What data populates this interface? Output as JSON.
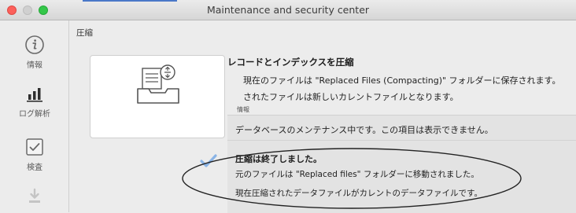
{
  "window": {
    "title": "Maintenance and security center"
  },
  "sidebar": {
    "items": [
      {
        "label": "情報",
        "icon": "info-icon"
      },
      {
        "label": "ログ解析",
        "icon": "bar-chart-icon"
      },
      {
        "label": "検査",
        "icon": "checkbox-icon"
      },
      {
        "label": "",
        "icon": "download-icon"
      }
    ]
  },
  "main": {
    "section_title": "圧縮",
    "operation": {
      "thumbnail_icon": "compact-tray-icon",
      "heading": "レコードとインデックスを圧縮",
      "desc_line1": "現在のファイルは \"Replaced Files (Compacting)\" フォルダーに保存されます。",
      "desc_line2": "されたファイルは新しいカレントファイルとなります。",
      "info_label": "情報"
    },
    "panel": {
      "maintenance_message": "データベースのメンテナンス中です。この項目は表示できません。",
      "done_title": "圧縮は終了しました。",
      "done_line1": "元のファイルは \"Replaced files\" フォルダーに移動されました。",
      "done_line2": "現在圧縮されたデータファイルがカレントのデータファイルです。",
      "status_icon": "checkmark-icon"
    }
  },
  "colors": {
    "accent": "#4a78c8",
    "check": "#8ab4e6",
    "close": "#fc605b",
    "zoom": "#34c749"
  }
}
